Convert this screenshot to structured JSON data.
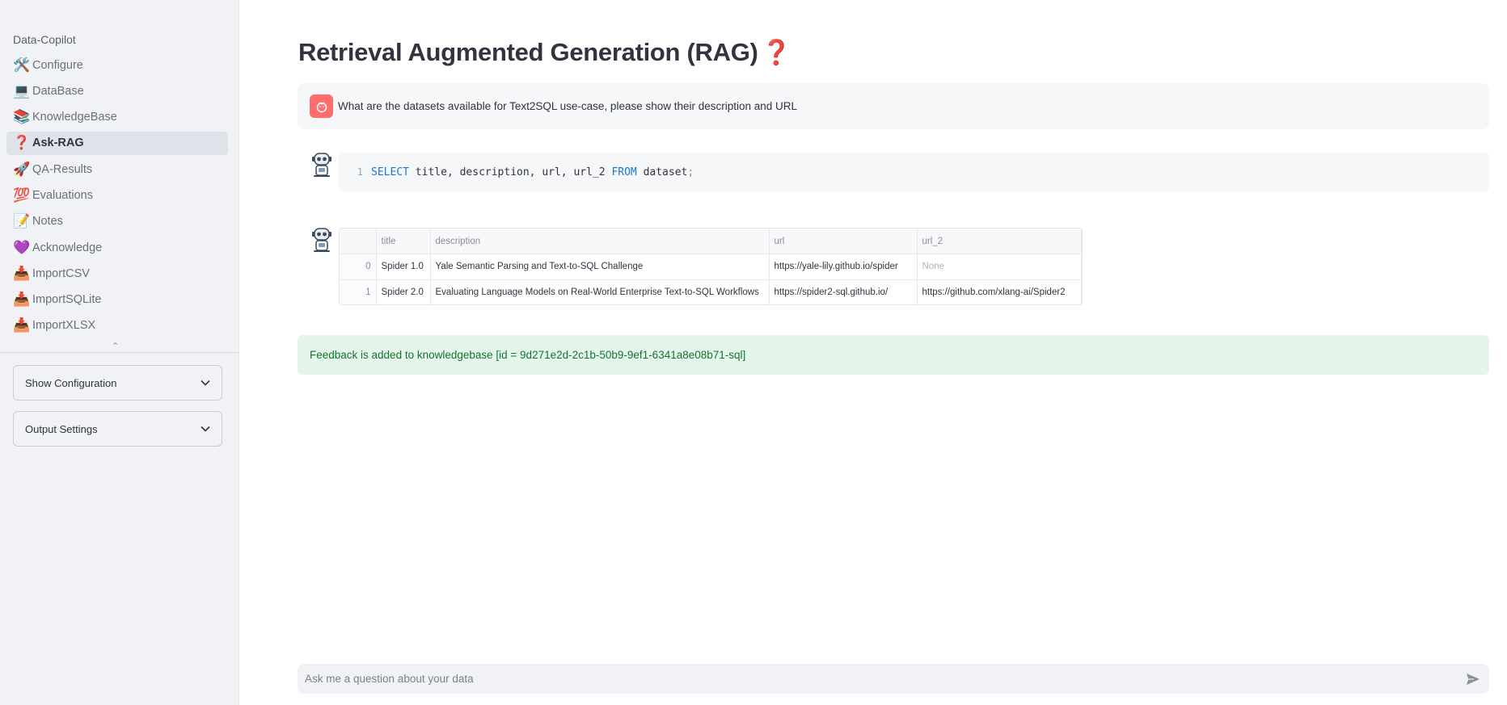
{
  "sidebar": {
    "app_name": "Data-Copilot",
    "items": [
      {
        "icon": "🛠️",
        "icon_name": "tools-icon",
        "label": "Configure"
      },
      {
        "icon": "💻",
        "icon_name": "laptop-icon",
        "label": "DataBase"
      },
      {
        "icon": "📚",
        "icon_name": "books-icon",
        "label": "KnowledgeBase"
      },
      {
        "icon": "❓",
        "icon_name": "question-icon",
        "label": "Ask-RAG",
        "active": true
      },
      {
        "icon": "🚀",
        "icon_name": "rocket-icon",
        "label": "QA-Results"
      },
      {
        "icon": "💯",
        "icon_name": "hundred-icon",
        "label": "Evaluations"
      },
      {
        "icon": "📝",
        "icon_name": "memo-icon",
        "label": "Notes"
      },
      {
        "icon": "💜",
        "icon_name": "purple-heart-icon",
        "label": "Acknowledge"
      },
      {
        "icon": "📥",
        "icon_name": "inbox-tray-icon",
        "label": "ImportCSV"
      },
      {
        "icon": "📥",
        "icon_name": "inbox-tray-icon",
        "label": "ImportSQLite"
      },
      {
        "icon": "📥",
        "icon_name": "inbox-tray-icon",
        "label": "ImportXLSX"
      }
    ],
    "expanders": {
      "show_config": "Show Configuration",
      "output_settings": "Output Settings"
    }
  },
  "main": {
    "title": "Retrieval Augmented Generation (RAG)",
    "title_icon": "❓",
    "user_question": "What are the datasets available for Text2SQL use-case, please show their description and URL",
    "sql": {
      "line_number": "1",
      "tokens": {
        "select": "SELECT",
        "cols": "title, description, url, url_2",
        "from": "FROM",
        "table": "dataset",
        "end": ";"
      }
    },
    "result_table": {
      "columns": [
        "",
        "title",
        "description",
        "url",
        "url_2"
      ],
      "rows": [
        [
          "0",
          "Spider 1.0",
          "Yale Semantic Parsing and Text-to-SQL Challenge",
          "https://yale-lily.github.io/spider",
          "None"
        ],
        [
          "1",
          "Spider 2.0",
          "Evaluating Language Models on Real-World Enterprise Text-to-SQL Workflows",
          "https://spider2-sql.github.io/",
          "https://github.com/xlang-ai/Spider2"
        ]
      ]
    },
    "feedback": "Feedback is added to knowledgebase [id = 9d271e2d-2c1b-50b9-9ef1-6341a8e08b71-sql]"
  },
  "chat_input": {
    "placeholder": "Ask me a question about your data"
  },
  "colors": {
    "sidebar_bg": "#f0f2f6",
    "accent_red": "#ff6c6c",
    "success_bg": "#e4f6ea",
    "success_text": "#177233",
    "sql_keyword": "#1976d2"
  }
}
